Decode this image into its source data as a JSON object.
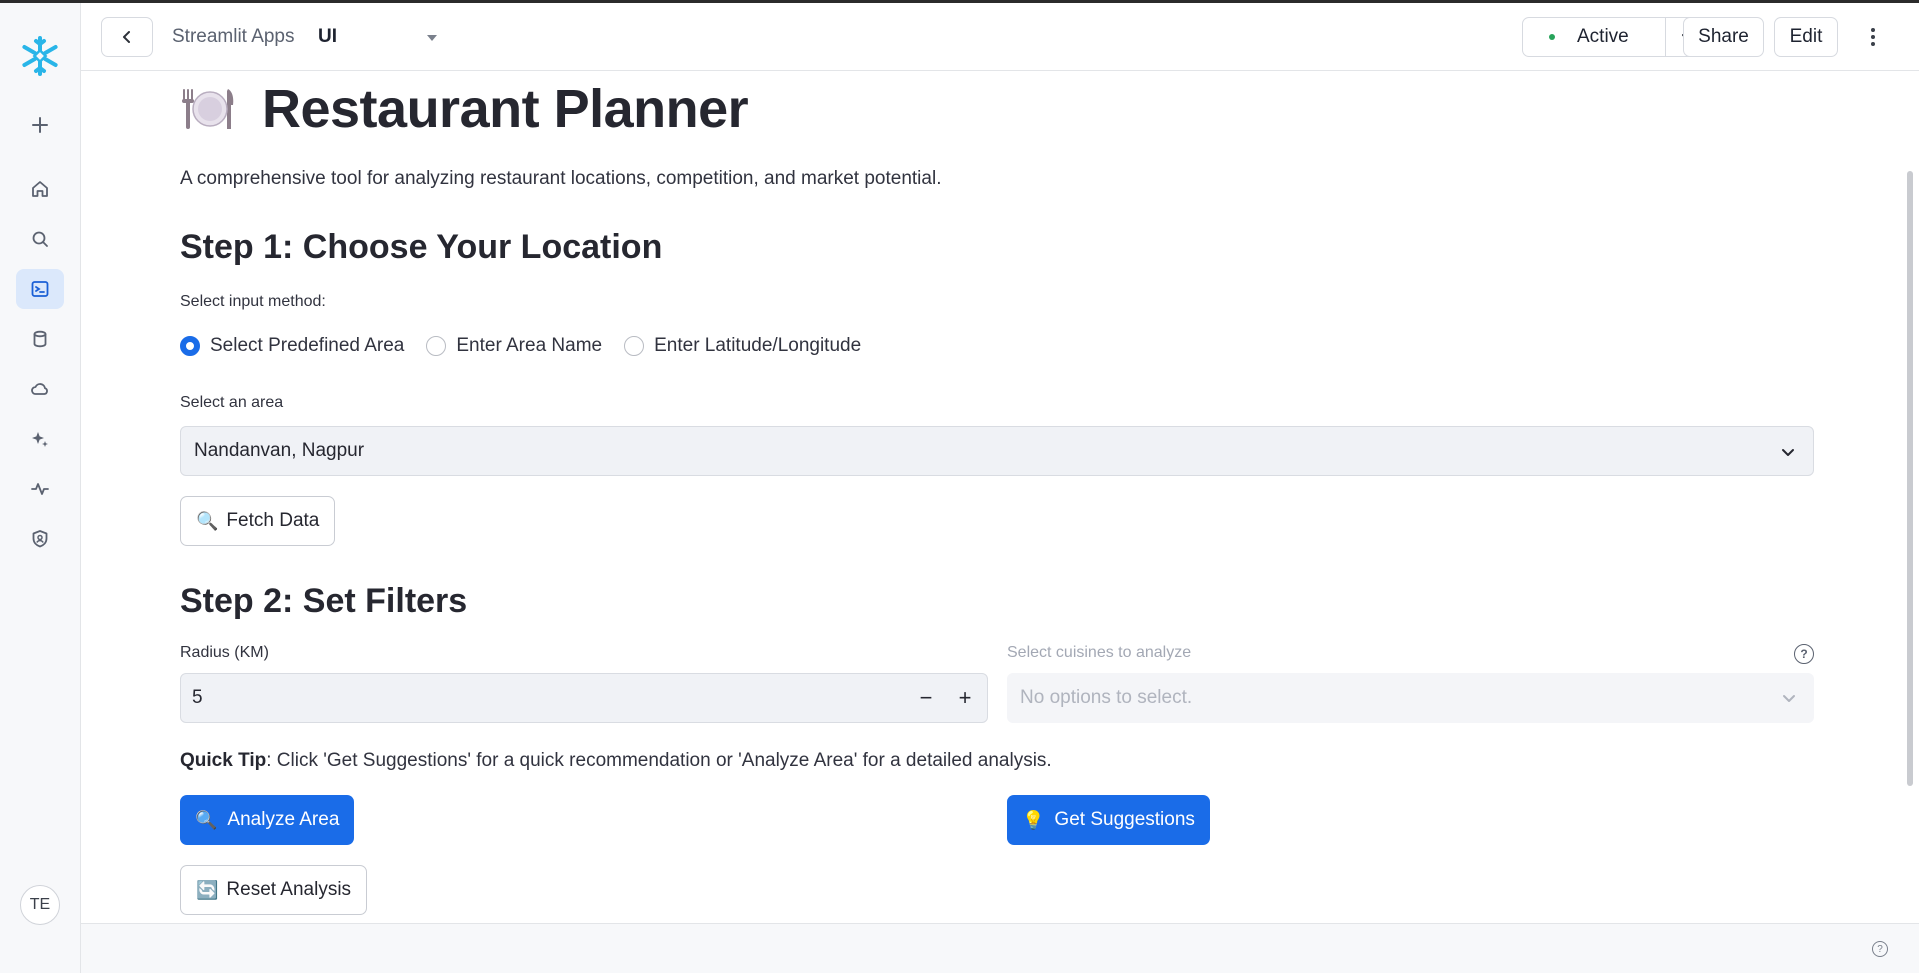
{
  "header": {
    "breadcrumb_parent": "Streamlit Apps",
    "breadcrumb_current": "UI",
    "status_label": "Active",
    "share_label": "Share",
    "edit_label": "Edit"
  },
  "sidebar": {
    "items": [
      {
        "icon": "plus-icon"
      },
      {
        "icon": "home-icon"
      },
      {
        "icon": "search-icon"
      },
      {
        "icon": "terminal-icon",
        "active": true
      },
      {
        "icon": "database-icon"
      },
      {
        "icon": "cloud-icon"
      },
      {
        "icon": "sparkle-icon"
      },
      {
        "icon": "activity-icon"
      },
      {
        "icon": "shield-icon"
      }
    ],
    "avatar_initials": "TE"
  },
  "main": {
    "title": "Restaurant Planner",
    "subtitle": "A comprehensive tool for analyzing restaurant locations, competition, and market potential.",
    "step1_heading": "Step 1: Choose Your Location",
    "input_method_label": "Select input method:",
    "input_methods": [
      "Select Predefined Area",
      "Enter Area Name",
      "Enter Latitude/Longitude"
    ],
    "selected_input_method": "Select Predefined Area",
    "area_label": "Select an area",
    "area_value": "Nandanvan, Nagpur",
    "fetch_button": "Fetch Data",
    "step2_heading": "Step 2: Set Filters",
    "radius_label": "Radius (KM)",
    "radius_value": "5",
    "cuisines_label": "Select cuisines to analyze",
    "cuisines_placeholder": "No options to select.",
    "tip_bold": "Quick Tip",
    "tip_text": ": Click 'Get Suggestions' for a quick recommendation or 'Analyze Area' for a detailed analysis.",
    "analyze_button": "Analyze Area",
    "suggestions_button": "Get Suggestions",
    "reset_button": "Reset Analysis"
  },
  "colors": {
    "primary": "#1a6ce8",
    "active_status": "#27a35a",
    "snowflake": "#29b5e8"
  }
}
